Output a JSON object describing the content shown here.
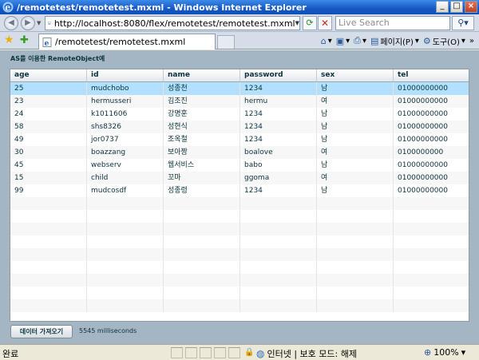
{
  "window": {
    "title": "/remotetest/remotetest.mxml - Windows Internet Explorer",
    "buttons": {
      "minimize": "_",
      "maximize": "□",
      "close": "×"
    }
  },
  "address_bar": {
    "url": "http://localhost:8080/flex/remotetest/remotetest.mxml",
    "search_placeholder": "Live Search"
  },
  "tab": {
    "title": "/remotetest/remotetest.mxml"
  },
  "toolbar": {
    "page_label": "페이지(P)",
    "tools_label": "도구(O)"
  },
  "app": {
    "title": "AS를 이용한 RemoteObject예",
    "columns": [
      "age",
      "id",
      "name",
      "password",
      "sex",
      "tel"
    ],
    "rows": [
      [
        "25",
        "mudchobo",
        "성종천",
        "1234",
        "남",
        "01000000000"
      ],
      [
        "23",
        "hermusseri",
        "김조진",
        "hermu",
        "여",
        "01000000000"
      ],
      [
        "24",
        "k1011606",
        "강명훈",
        "1234",
        "남",
        "01000000000"
      ],
      [
        "58",
        "shs8326",
        "성현식",
        "1234",
        "남",
        "01000000000"
      ],
      [
        "49",
        "jor0737",
        "조옥철",
        "1234",
        "남",
        "01000000000"
      ],
      [
        "30",
        "boazzang",
        "보아짱",
        "boalove",
        "여",
        "0100000000"
      ],
      [
        "45",
        "webserv",
        "웹서비스",
        "babo",
        "남",
        "01000000000"
      ],
      [
        "15",
        "child",
        "꼬마",
        "ggoma",
        "여",
        "01000000000"
      ],
      [
        "99",
        "mudcosdf",
        "성종령",
        "1234",
        "남",
        "01000000000"
      ]
    ],
    "selected_row_index": 0,
    "fetch_button_label": "데이터 가져오기",
    "elapsed_text": "5545 milliseconds"
  },
  "status_bar": {
    "text": "완료",
    "zone": "인터넷 | 보호 모드: 해제",
    "zoom": "100%"
  }
}
